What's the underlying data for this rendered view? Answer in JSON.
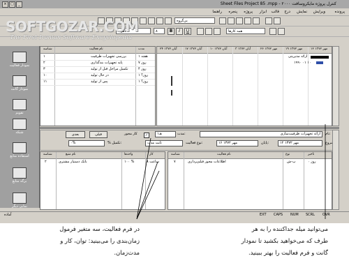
{
  "window": {
    "title": "Sheet Files Project 85 .mpp - ۲۰۰۰ کنترل پروژه مایکروسافت"
  },
  "menu": [
    "پرونده",
    "ویرایش",
    "نمایش",
    "درج",
    "قالب",
    "ابزار",
    "پروژه",
    "پنجره",
    "راهنما"
  ],
  "toolbar": {
    "group_combo": "بی‌گروه",
    "font_combo": "تاهوما",
    "size_combo": "۸",
    "filter_combo": "همه کارها",
    "bold": "B",
    "italic": "I",
    "underline": "U"
  },
  "watermark": {
    "logo": "SOFTGOZAR.COM",
    "subtitle": "The First Iranian Software Encyclopedia"
  },
  "viewbar": [
    {
      "label": "نمودار فعالیت"
    },
    {
      "label": "نمودار گانت"
    },
    {
      "label": "تقویم"
    },
    {
      "label": "شبکه"
    },
    {
      "label": "استفاده منابع"
    },
    {
      "label": "برگه منابع"
    },
    {
      "label": "نمایی دیگر"
    }
  ],
  "gantt_table": {
    "columns": [
      "شناسه",
      "نام فعالیت",
      "مدت"
    ],
    "rows": [
      {
        "id": "۱",
        "name": "بررسی تجهیزات ظرفیت",
        "duration": "۱ هفته"
      },
      {
        "id": "۲",
        "name": "پایه تجهیزات بندگذاری",
        "duration": "۷ روز"
      },
      {
        "id": "۳",
        "name": "تکمیل مراحل قبل از تولید",
        "duration": "۴ روز"
      },
      {
        "id": "۱۰",
        "name": "در حال تولید",
        "duration": "۱ روز؟"
      },
      {
        "id": "۱۱",
        "name": "پس از تولید",
        "duration": "۱ روز؟"
      }
    ]
  },
  "timescale": {
    "months": [
      "۱۲ مهر ۱۳۷۲",
      "۱۹ مهر ۱۳۷۲",
      "۲۶ مهر ۱۳۷۲",
      "۳ آبان ۱۳۷۲",
      "۱۰ آبان ۱۳۷۲",
      "۱۷ آبان ۱۳۷۲",
      "۲۴ آبان ۱۳۷۲"
    ]
  },
  "gantt_chart": {
    "summary_label": "ارائه مدیریتی",
    "task_label": "۱۹۹۰ ۰۱ ۱۰"
  },
  "task_form": {
    "name_label": "نام:",
    "name_value": "ارائه تجهیزات ظرفیت‌سازی",
    "duration_label": "مدت:",
    "duration_value": "۱هـ",
    "effort_driven_label": "کار محور",
    "prev_button": "قبلی",
    "next_button": "بعدی",
    "start_label": "شروع:",
    "start_value": "۱۲ مهر ۱۳۷۲",
    "finish_label": "پایان:",
    "finish_value": "۱۶ مهر ۱۳۷۲",
    "task_type_label": "نوع فعالیت:",
    "task_type_value": "ثابت مدت",
    "complete_label": "% تکمیل:",
    "complete_value": "۰%"
  },
  "resource_table": {
    "columns": [
      "شناسه",
      "نام منبع",
      "واحدها",
      "کار"
    ],
    "rows": [
      {
        "id": "۲",
        "name": "بانک دستیار مشتری",
        "units": "۱۰۰ %",
        "work": "۸ ساعت"
      }
    ]
  },
  "predecessor_table": {
    "columns": [
      "شناسه",
      "نام فعالیت",
      "نوع",
      "تأخیر"
    ],
    "rows": [
      {
        "id": "۷",
        "name": "اطلاعات مجوز فیلم‌برداری",
        "type": "پ-ش",
        "lag": "۰ روز"
      }
    ]
  },
  "status": {
    "ready": "آماده",
    "indicators": [
      "EXT",
      "CAPS",
      "NUM",
      "SCRL",
      "OVR"
    ]
  },
  "captions": {
    "left": [
      "در فرم فعالیت، سه متغیر فرمول",
      "زمان‌بندی را می‌بینید: توان، کار و",
      "مدت‌زمان."
    ],
    "right": [
      "می‌توانید میله جداکننده را به هر",
      "طرف که می‌خواهید بکشید تا نمودار",
      "گانت و فرم فعالیت را بهتر ببینید."
    ]
  }
}
